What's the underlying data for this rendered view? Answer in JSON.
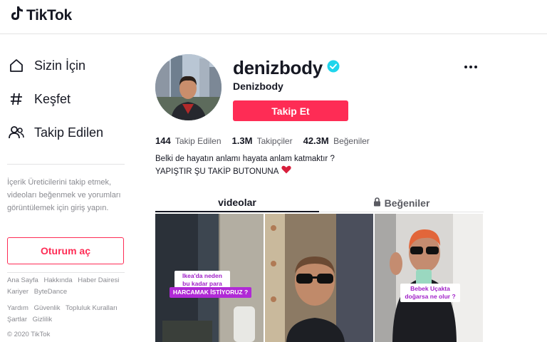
{
  "app": {
    "logo_text": "TikTok"
  },
  "sidebar": {
    "nav": [
      {
        "label": "Sizin İçin",
        "icon": "home-icon"
      },
      {
        "label": "Keşfet",
        "icon": "hashtag-icon"
      },
      {
        "label": "Takip Edilen",
        "icon": "users-icon"
      }
    ],
    "login_hint": "İçerik Üreticilerini takip etmek, videoları beğenmek ve yorumları görüntülemek için giriş yapın.",
    "login_button": "Oturum aç",
    "footer_links_row1": [
      "Ana Sayfa",
      "Hakkında",
      "Haber Dairesi",
      "Kariyer",
      "ByteDance"
    ],
    "footer_links_row2": [
      "Yardım",
      "Güvenlik",
      "Topluluk Kuralları",
      "Şartlar",
      "Gizlilik"
    ],
    "copyright": "© 2020 TikTok"
  },
  "profile": {
    "username": "denizbody",
    "display_name": "Denizbody",
    "verified": true,
    "follow_button": "Takip Et",
    "stats": [
      {
        "value": "144",
        "label": "Takip Edilen"
      },
      {
        "value": "1.3M",
        "label": "Takipçiler"
      },
      {
        "value": "42.3M",
        "label": "Beğeniler"
      }
    ],
    "bio_line1": "Belki de hayatın anlamı hayata anlam katmaktır ?",
    "bio_line2": "YAPIŞTIR ŞU TAKİP BUTONUNA"
  },
  "tabs": {
    "videos": "videolar",
    "likes": "Beğeniler"
  },
  "videos": [
    {
      "caption_lines": [
        "Ikea'da neden",
        "bu kadar para"
      ],
      "caption_highlight": "HARCAMAK İSTİYORUZ ?"
    },
    {
      "caption_lines": [],
      "caption_highlight": ""
    },
    {
      "caption_lines": [],
      "caption_highlight": "Bebek Uçakta doğarsa ne olur ?"
    }
  ],
  "colors": {
    "brand": "#fe2c55",
    "verified": "#20d5ec",
    "caption": "#b029d6"
  }
}
